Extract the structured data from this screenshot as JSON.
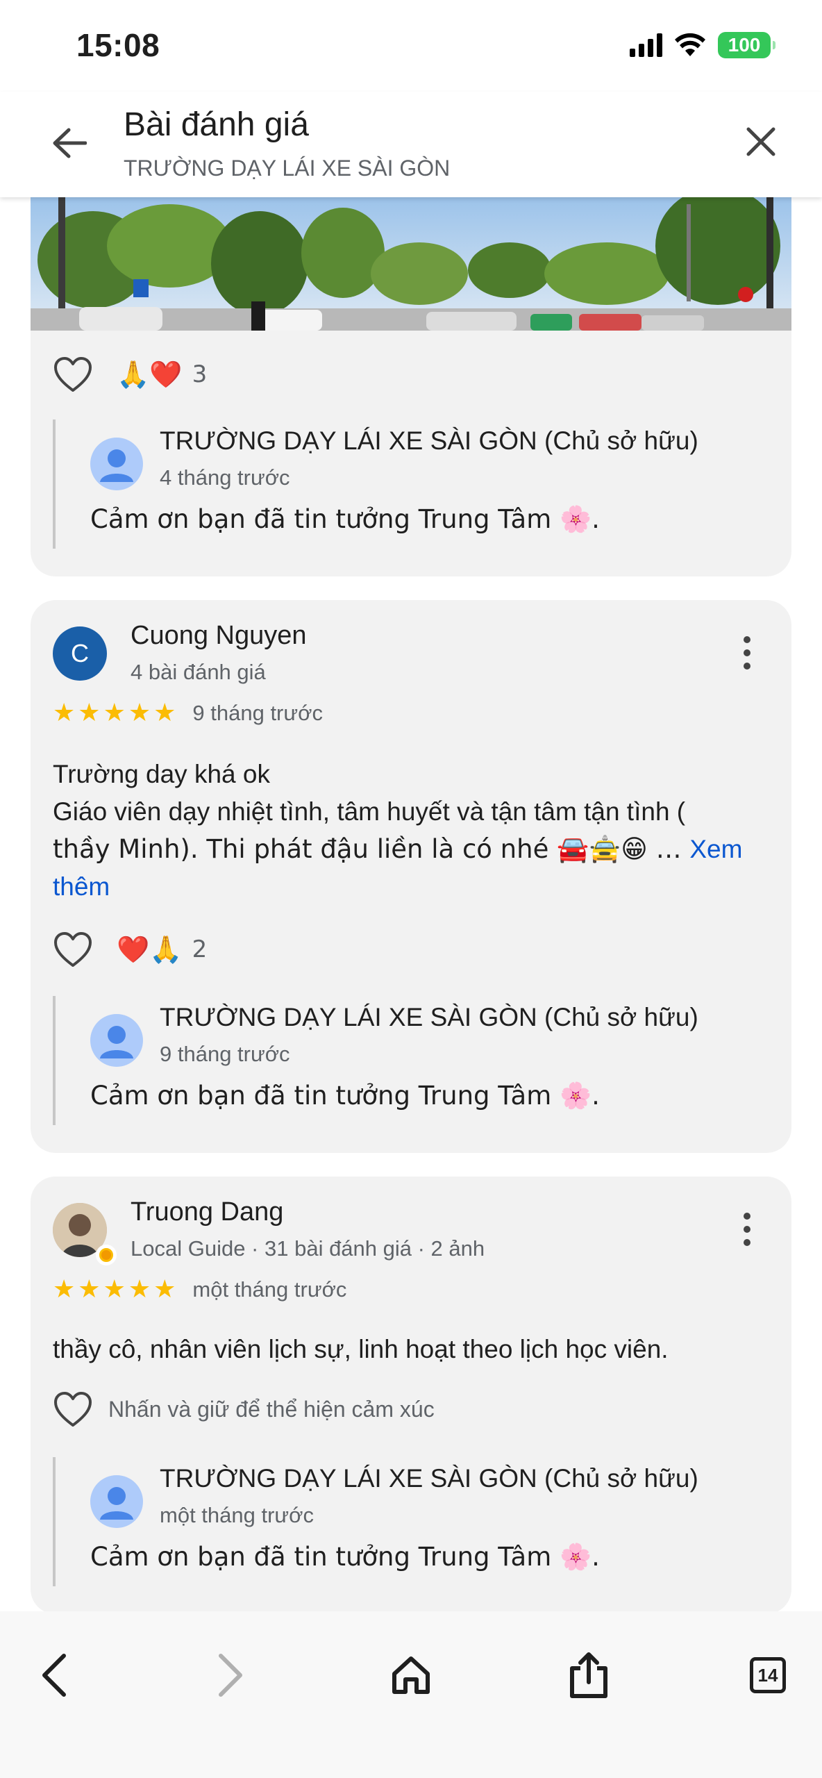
{
  "status_bar": {
    "time": "15:08",
    "battery": "100"
  },
  "header": {
    "title": "Bài đánh giá",
    "subtitle": "TRƯỜNG DẠY LÁI XE SÀI GÒN"
  },
  "reviews": [
    {
      "reactions": {
        "emojis": "🙏❤️",
        "count": "3"
      },
      "owner_reply": {
        "name": "TRƯỜNG DẠY LÁI XE SÀI GÒN (Chủ sở hữu)",
        "time": "4 tháng trước",
        "text": "Cảm ơn bạn đã tin tưởng Trung Tâm 🌸."
      }
    },
    {
      "reviewer": {
        "name": "Cuong Nguyen",
        "initial": "C",
        "meta": "4 bài đánh giá"
      },
      "rating": 5,
      "time": "9 tháng trước",
      "text_line1": "Trường day khá ok",
      "text_line2": "Giáo viên dạy nhiệt tình, tâm huyết và tận tâm tận tình (",
      "text_line3": "thầy Minh). Thi phát đậu liền là có nhé 🚘🚖😁 … ",
      "see_more": "Xem thêm",
      "reactions": {
        "emojis": "❤️🙏",
        "count": "2"
      },
      "owner_reply": {
        "name": "TRƯỜNG DẠY LÁI XE SÀI GÒN (Chủ sở hữu)",
        "time": "9 tháng trước",
        "text": "Cảm ơn bạn đã tin tưởng Trung Tâm 🌸."
      }
    },
    {
      "reviewer": {
        "name": "Truong Dang",
        "meta": "Local Guide · 31 bài đánh giá · 2 ảnh"
      },
      "rating": 5,
      "time": "một tháng trước",
      "text": "thầy cô, nhân viên lịch sự, linh hoạt theo lịch học viên.",
      "reaction_hint": "Nhấn và giữ để thể hiện cảm xúc",
      "owner_reply": {
        "name": "TRƯỜNG DẠY LÁI XE SÀI GÒN (Chủ sở hữu)",
        "time": "một tháng trước",
        "text": "Cảm ơn bạn đã tin tưởng Trung Tâm 🌸."
      }
    }
  ],
  "toolbar": {
    "tabs_count": "14"
  },
  "colors": {
    "accent": "#0b57d0",
    "star": "#fbbc04",
    "card": "#f2f2f2",
    "battery": "#34c759"
  }
}
